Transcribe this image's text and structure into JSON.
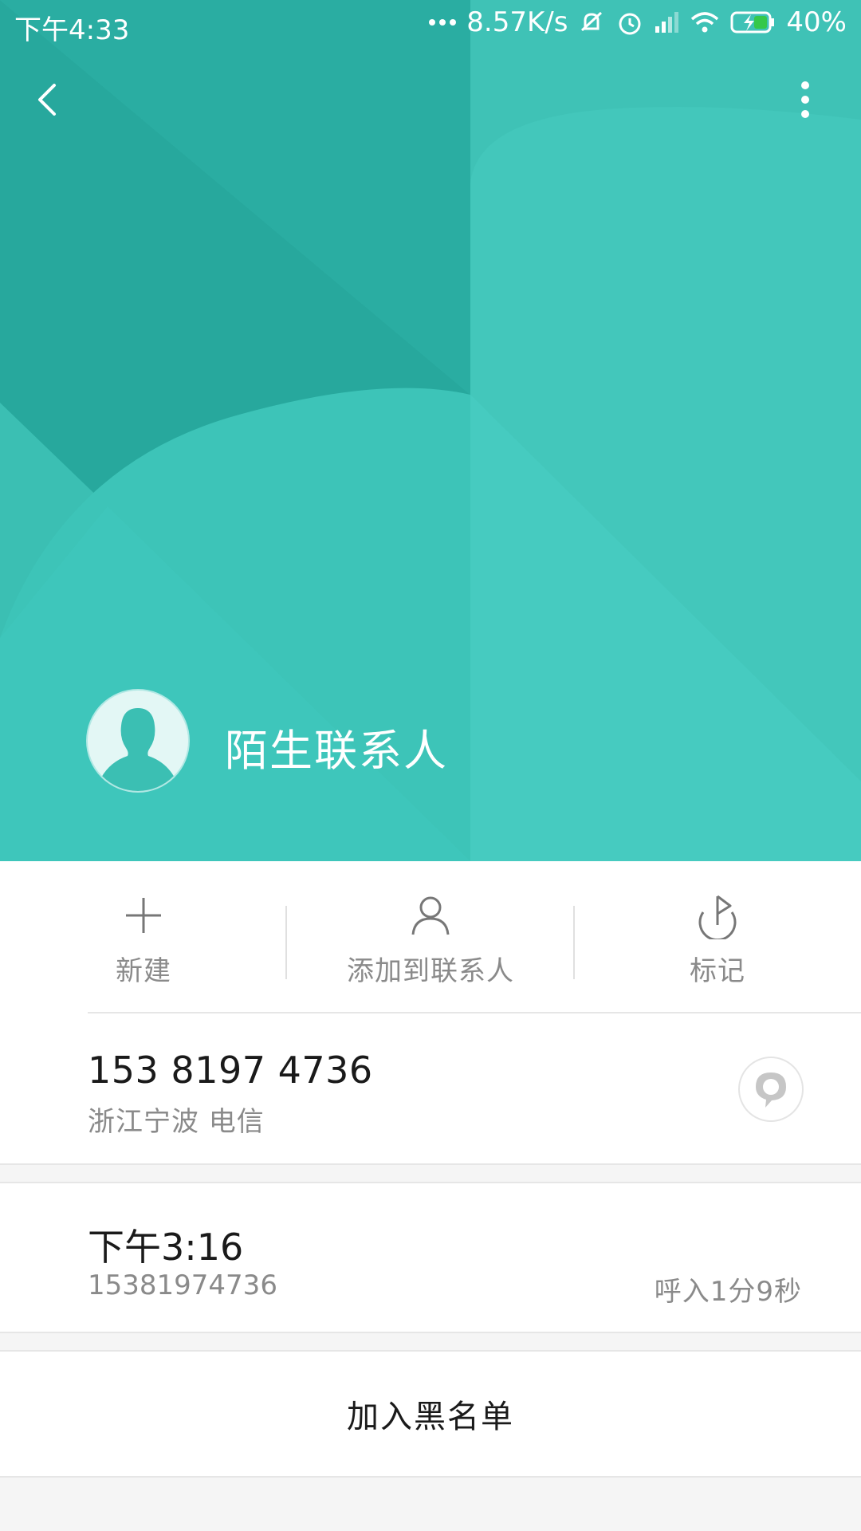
{
  "status_bar": {
    "time": "下午4:33",
    "network_speed": "8.57K/s",
    "battery": "40%",
    "icons": [
      "more-dots-icon",
      "mute-icon",
      "alarm-icon",
      "signal-icon",
      "wifi-icon",
      "battery-charging-icon"
    ]
  },
  "header": {
    "back_icon": "chevron-left-icon",
    "more_icon": "more-vertical-icon",
    "contact_name": "陌生联系人",
    "colors": {
      "teal_base": "#3bbfb3",
      "teal_dark": "#27a89d",
      "teal_light": "#46cbc0"
    }
  },
  "actions": [
    {
      "label": "新建",
      "icon": "plus-icon"
    },
    {
      "label": "添加到联系人",
      "icon": "person-icon"
    },
    {
      "label": "标记",
      "icon": "flag-icon"
    }
  ],
  "phone": {
    "number": "153 8197 4736",
    "location": "浙江宁波 电信",
    "message_icon": "message-bubble-icon"
  },
  "call_log": {
    "time": "下午3:16",
    "number": "15381974736",
    "duration": "呼入1分9秒"
  },
  "blacklist": {
    "label": "加入黑名单"
  }
}
